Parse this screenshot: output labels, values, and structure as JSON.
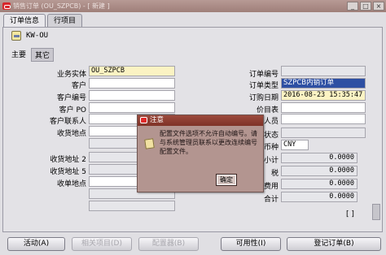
{
  "titlebar": {
    "text": "销售订单 (OU_SZPCB) - [ 新建 ]",
    "buttons": [
      "_",
      "□",
      "×"
    ]
  },
  "tabs": [
    {
      "label": "订单信息",
      "active": true
    },
    {
      "label": "行项目",
      "active": false
    }
  ],
  "record": {
    "label": "KW-OU"
  },
  "subtabs": [
    {
      "label": "主要",
      "active": false
    },
    {
      "label": "其它",
      "active": true
    }
  ],
  "left_fields": [
    {
      "label": "业务实体",
      "value": "OU_SZPCB"
    },
    {
      "label": "客户",
      "value": ""
    },
    {
      "label": "客户编号",
      "value": ""
    },
    {
      "label": "客户 PO",
      "value": ""
    },
    {
      "label": "客户联系人",
      "value": ""
    },
    {
      "label": "收货地点",
      "value": ""
    },
    {
      "label": "收货地址 2",
      "value": ""
    },
    {
      "label": "收货地址 5",
      "value": ""
    },
    {
      "label": "收单地点",
      "value": ""
    }
  ],
  "right_fields": [
    {
      "label": "订单编号",
      "value": ""
    },
    {
      "label": "订单类型",
      "value": "SZPCB内销订单"
    },
    {
      "label": "订购日期",
      "value": "2016-08-23 15:35:47"
    },
    {
      "label": "价目表",
      "value": ""
    },
    {
      "label": "销售人员",
      "value": ""
    },
    {
      "label": "状态",
      "value": ""
    },
    {
      "label": "币种",
      "value": "CNY"
    },
    {
      "label": "小计",
      "value": "0.0000"
    },
    {
      "label": "税",
      "value": "0.0000"
    },
    {
      "label": "费用",
      "value": "0.0000"
    },
    {
      "label": "合计",
      "value": "0.0000"
    }
  ],
  "bracket": "[ ]",
  "buttons": [
    {
      "label": "活动(A)",
      "enabled": true
    },
    {
      "label": "相关项目(D)",
      "enabled": false
    },
    {
      "label": "配置器(B)",
      "enabled": false
    },
    {
      "label": "可用性(I)",
      "enabled": true
    },
    {
      "label": "登记订单(B)",
      "enabled": true
    }
  ],
  "dialog": {
    "title": "注意",
    "message": "配置文件选项不允许自动编号。请与系统管理员联系以更改连续编号配置文件。",
    "ok_label": "确定"
  },
  "colors": {
    "titlebar": "#a5857f",
    "required_field": "#fbf3c3",
    "selected_value": "#2d4fa3",
    "dialog_title": "#8b3b2f"
  }
}
